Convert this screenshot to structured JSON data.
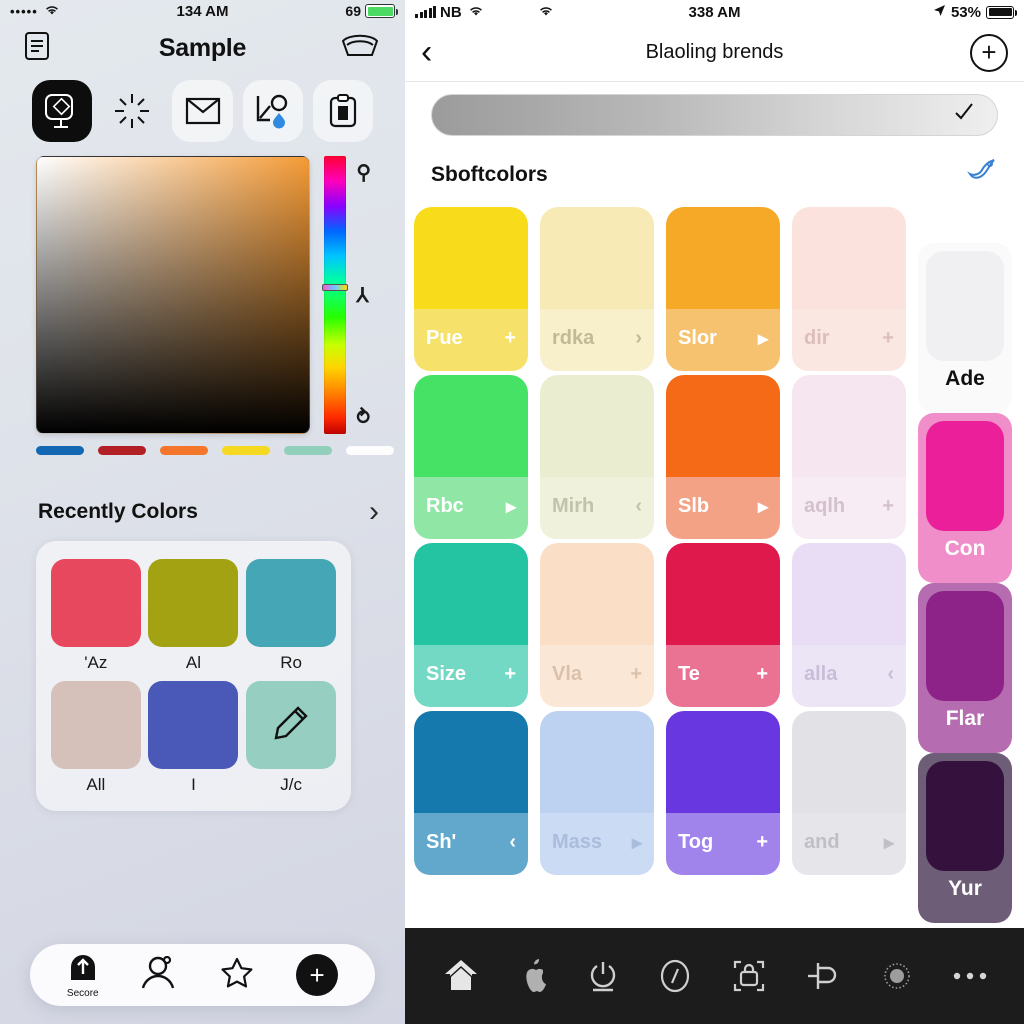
{
  "left": {
    "status": {
      "dots": "•••••",
      "wifi_icon": "wifi-icon",
      "time": "134 AM",
      "battery_pct": "69"
    },
    "header": {
      "doc_icon": "document-icon",
      "title": "Sample",
      "fan_icon": "fan-icon"
    },
    "tools": [
      {
        "name": "screen-stamp-icon",
        "label": "",
        "active": true
      },
      {
        "name": "sparkle-burst-icon",
        "label": "",
        "active": false
      },
      {
        "name": "envelope-chart-icon",
        "label": "",
        "active": false
      },
      {
        "name": "droplet-graph-icon",
        "label": "",
        "active": false
      },
      {
        "name": "clipboard-icon",
        "label": "",
        "active": false
      }
    ],
    "picker": {
      "gradient_to": "#f59b36",
      "hue_glyphs": [
        "⚲",
        "⅄",
        "⥁"
      ],
      "swatches": [
        "#1268b3",
        "#b22026",
        "#f3762a",
        "#f5d820",
        "#91cfbb",
        "#fdfdfd"
      ]
    },
    "recent": {
      "title": "Recently Colors",
      "chevron": "›",
      "items": [
        {
          "label": "'Az",
          "color": "#e8485e",
          "icon": ""
        },
        {
          "label": "Al",
          "color": "#a2a213",
          "icon": ""
        },
        {
          "label": "Ro",
          "color": "#45a7b5",
          "icon": ""
        },
        {
          "label": "All",
          "color": "#d5c0ba",
          "icon": ""
        },
        {
          "label": "I",
          "color": "#4a58b8",
          "icon": ""
        },
        {
          "label": "J/c",
          "color": "#96cfc1",
          "icon": "pencil-icon"
        }
      ]
    },
    "tabbar": [
      {
        "name": "secure-tab",
        "label": "Secore",
        "icon": "arch-up-arrow-icon"
      },
      {
        "name": "profile-tab",
        "label": "",
        "icon": "person-icon"
      },
      {
        "name": "favorites-tab",
        "label": "",
        "icon": "star-icon"
      },
      {
        "name": "add-tab",
        "label": "",
        "icon": "plus-circle-icon"
      }
    ]
  },
  "right": {
    "status": {
      "carrier": "NB",
      "wifi_icon": "wifi-icon",
      "time": "338 AM",
      "battery_pct": "53%",
      "location_icon": "location-icon"
    },
    "navbar": {
      "back_icon": "chevron-left-icon",
      "title": "Blaoling brends",
      "add_icon": "plus-circle-icon"
    },
    "search": {
      "value": "",
      "placeholder": "",
      "trailing_icon": "checkmark-icon"
    },
    "section": {
      "title": "Sboftcolors",
      "action_icon": "ribbon-icon"
    },
    "grid": [
      [
        {
          "label": "Pue",
          "action": "+",
          "tile": "#f8dc1c",
          "bar": "#f6e26b",
          "faded": false
        },
        {
          "label": "rdka",
          "action": "›",
          "tile": "#f7eab5",
          "bar": "#f8efcb",
          "faded": true
        },
        {
          "label": "Slor",
          "action": "▸",
          "tile": "#f6a827",
          "bar": "#f6c270",
          "faded": false
        },
        {
          "label": "dir",
          "action": "+",
          "tile": "#fbe2dc",
          "bar": "#fbe7e2",
          "faded": true
        }
      ],
      [
        {
          "label": "Rbc",
          "action": "▸",
          "tile": "#45e266",
          "bar": "#8fe6a5",
          "faded": false
        },
        {
          "label": "Mirh",
          "action": "‹",
          "tile": "#eaedcf",
          "bar": "#eff1dc",
          "faded": true
        },
        {
          "label": "Slb",
          "action": "▸",
          "tile": "#f46a16",
          "bar": "#f4a285",
          "faded": false
        },
        {
          "label": "aqlh",
          "action": "+",
          "tile": "#f5e6f0",
          "bar": "#f7ecf3",
          "faded": true
        }
      ],
      [
        {
          "label": "Size",
          "action": "+",
          "tile": "#24c3a2",
          "bar": "#74d9c4",
          "faded": false
        },
        {
          "label": "Vla",
          "action": "+",
          "tile": "#fadfc6",
          "bar": "#fbe7d6",
          "faded": true
        },
        {
          "label": "Te",
          "action": "+",
          "tile": "#e0194c",
          "bar": "#ea7393",
          "faded": false
        },
        {
          "label": "alla",
          "action": "‹",
          "tile": "#e8ddf4",
          "bar": "#ece5f6",
          "faded": true
        }
      ],
      [
        {
          "label": "Sh'",
          "action": "‹",
          "tile": "#1579ad",
          "bar": "#62a8cc",
          "faded": false
        },
        {
          "label": "Mass",
          "action": "▸",
          "tile": "#bdd1f0",
          "bar": "#cbdbf4",
          "faded": true
        },
        {
          "label": "Tog",
          "action": "+",
          "tile": "#6937e0",
          "bar": "#a183ec",
          "faded": false
        },
        {
          "label": "and",
          "action": "▸",
          "tile": "#e2e1e6",
          "bar": "#e6e5ea",
          "faded": true
        }
      ]
    ],
    "side_stack": [
      {
        "label": "Ade",
        "tile": "#f0f0f2",
        "base": "#fafafa",
        "text": "#111111"
      },
      {
        "label": "Con",
        "tile": "#ec1f9b",
        "base": "#f08ec9",
        "text": "#ffffff"
      },
      {
        "label": "Flar",
        "tile": "#8d2288",
        "base": "#b56cb1",
        "text": "#ffffff"
      },
      {
        "label": "Yur",
        "tile": "#35113d",
        "base": "#6e5d77",
        "text": "#ffffff"
      }
    ],
    "dock": [
      {
        "name": "home-icon"
      },
      {
        "name": "apple-icon"
      },
      {
        "name": "power-icon"
      },
      {
        "name": "clock-icon"
      },
      {
        "name": "lock-screen-icon"
      },
      {
        "name": "pin-icon"
      },
      {
        "name": "brightness-icon"
      },
      {
        "name": "more-icon"
      }
    ]
  }
}
